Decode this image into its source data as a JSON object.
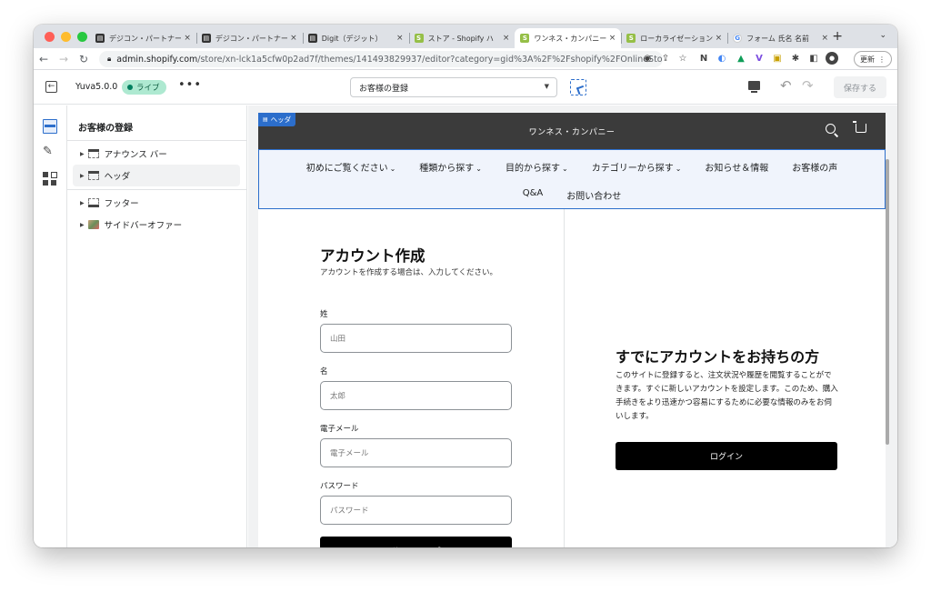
{
  "browser": {
    "tabs": [
      {
        "title": "デジコン・パートナー",
        "icon": "grid-icon",
        "active": false
      },
      {
        "title": "デジコン・パートナー",
        "icon": "grid-icon",
        "active": false
      },
      {
        "title": "Digit（デジット）",
        "icon": "grid-icon",
        "active": false
      },
      {
        "title": "ストア - Shopify ハ",
        "icon": "shopify-icon",
        "active": false
      },
      {
        "title": "ワンネス・カンパニー",
        "icon": "shopify-icon",
        "active": true
      },
      {
        "title": "ローカライゼーション",
        "icon": "shopify-icon",
        "active": false
      },
      {
        "title": "フォーム 氏名 名前",
        "icon": "google-icon",
        "active": false
      }
    ],
    "new_tab": "+",
    "url_host": "admin.shopify.com",
    "url_path": "/store/xn-lck1a5cfw0p2ad7f/themes/141493829937/editor?category=gid%3A%2F%2Fshopify%2FOnlineStor...",
    "update_label": "更新"
  },
  "editor": {
    "theme_name": "Yuva5.0.0",
    "status_badge": "ライブ",
    "page_select": "お客様の登録",
    "save_label": "保存する"
  },
  "panel": {
    "title": "お客様の登録",
    "items": [
      {
        "label": "アナウンス バー"
      },
      {
        "label": "ヘッダ"
      },
      {
        "label": "フッター"
      },
      {
        "label": "サイドバーオファー"
      }
    ]
  },
  "preview": {
    "section_tag": "ヘッダ",
    "store_name": "ワンネス・カンパニー",
    "nav_row1": [
      "初めにご覧ください",
      "種類から探す",
      "目的から探す",
      "カテゴリーから探す",
      "お知らせ＆情報",
      "お客様の声"
    ],
    "nav_row2": [
      "Q&A",
      "お問い合わせ"
    ],
    "signup": {
      "title": "アカウント作成",
      "desc": "アカウントを作成する場合は、入力してください。",
      "fields": [
        {
          "label": "姓",
          "placeholder": "山田"
        },
        {
          "label": "名",
          "placeholder": "太郎"
        },
        {
          "label": "電子メール",
          "placeholder": "電子メール"
        },
        {
          "label": "パスワード",
          "placeholder": "パスワード"
        }
      ],
      "button": "サインアップ"
    },
    "login": {
      "title": "すでにアカウントをお持ちの方",
      "desc": "このサイトに登録すると、注文状況や履歴を閲覧することができます。すぐに新しいアカウントを設定します。このため、購入手続きをより迅速かつ容易にするために必要な情報のみをお伺いします。",
      "button": "ログイン"
    }
  },
  "colors": {
    "accent": "#2c6ecb",
    "header_bg": "#3b3b3b",
    "live_badge": "#aee9d1"
  }
}
